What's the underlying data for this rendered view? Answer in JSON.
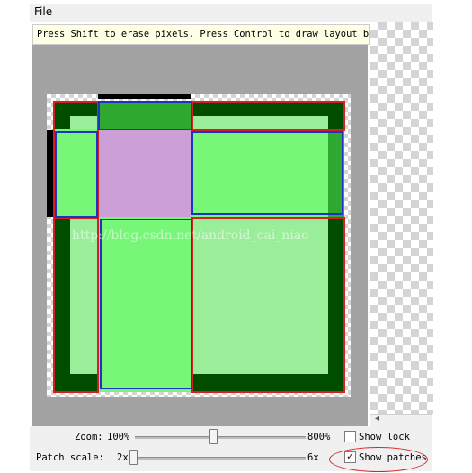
{
  "menu": {
    "file": "File"
  },
  "hint": {
    "text": "Press Shift to erase pixels. Press Control to draw layout bou"
  },
  "watermark": {
    "text": "http://blog.csdn.net/android_cai_niao"
  },
  "controls": {
    "zoom_label": "Zoom:",
    "zoom_min": "100%",
    "zoom_max": "800%",
    "show_lock_label": "Show lock",
    "show_lock_checked": false,
    "patch_scale_label": "Patch scale:",
    "patch_min": "2x",
    "patch_max": "6x",
    "show_patches_label": "Show patches",
    "show_patches_checked": true
  },
  "colors": {
    "dark_green": "#004d00",
    "light_green": "#9aee9a",
    "bright_green": "#78f678",
    "lilac": "#cc9fd6",
    "patch_red": "#d42020",
    "patch_blue": "#1d33c4"
  }
}
